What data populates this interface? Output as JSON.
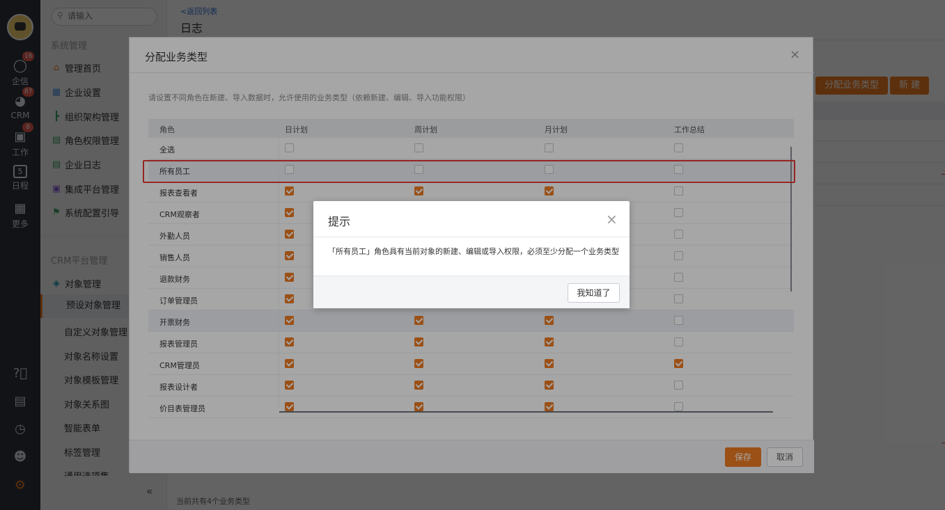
{
  "rail": {
    "items": [
      {
        "label": "企信",
        "icon": "chat-bubble-icon",
        "badge": "16"
      },
      {
        "label": "CRM",
        "icon": "pie-chart-icon",
        "badge": "87"
      },
      {
        "label": "工作",
        "icon": "briefcase-icon",
        "badge": "8"
      },
      {
        "label": "日程",
        "icon": "calendar-icon",
        "day": "5"
      },
      {
        "label": "更多",
        "icon": "grid-icon"
      }
    ],
    "bottom_icons": [
      "help-icon",
      "notebook-icon",
      "clock-icon",
      "contacts-icon",
      "gear-icon"
    ]
  },
  "menu": {
    "search_placeholder": "请输入",
    "section1": "系统管理",
    "items1": [
      {
        "label": "管理首页",
        "icon": "home-icon",
        "color": "#ee7c22"
      },
      {
        "label": "企业设置",
        "icon": "building-icon",
        "color": "#4a90e2"
      },
      {
        "label": "组织架构管理",
        "icon": "org-tree-icon",
        "color": "#3c9d5a"
      },
      {
        "label": "角色权限管理",
        "icon": "id-card-icon",
        "color": "#3c9d5a"
      },
      {
        "label": "企业日志",
        "icon": "log-icon",
        "color": "#3c9d5a"
      },
      {
        "label": "集成平台管理",
        "icon": "chip-icon",
        "color": "#8d5bd6"
      },
      {
        "label": "系统配置引导",
        "icon": "signpost-icon",
        "color": "#3c9d5a"
      }
    ],
    "section2": "CRM平台管理",
    "object_mgmt": "对象管理",
    "sub_items": [
      "预设对象管理",
      "自定义对象管理",
      "对象名称设置",
      "对象模板管理",
      "对象关系图",
      "智能表单",
      "标签管理",
      "通用选项集"
    ],
    "collapse": "«"
  },
  "page": {
    "back": "<返回列表",
    "title": "日志",
    "btn_assign": "分配业务类型",
    "btn_new": "新 建",
    "footer": "当前共有4个业务类型"
  },
  "dialog": {
    "title": "分配业务类型",
    "close": "×",
    "desc": "请设置不同角色在新建、导入数据时，允许使用的业务类型（依赖新建、编辑、导入功能权限）",
    "headers": [
      "角色",
      "日计划",
      "周计划",
      "月计划",
      "工作总结"
    ],
    "rows": [
      {
        "name": "全选",
        "checks": [
          false,
          false,
          false,
          false
        ]
      },
      {
        "name": "所有员工",
        "checks": [
          false,
          false,
          false,
          false
        ]
      },
      {
        "name": "报表查看者",
        "checks": [
          true,
          true,
          true,
          false
        ]
      },
      {
        "name": "CRM观察者",
        "checks": [
          true,
          true,
          true,
          false
        ]
      },
      {
        "name": "外勤人员",
        "checks": [
          true,
          true,
          true,
          false
        ]
      },
      {
        "name": "销售人员",
        "checks": [
          true,
          true,
          true,
          false
        ]
      },
      {
        "name": "退款财务",
        "checks": [
          true,
          true,
          true,
          false
        ]
      },
      {
        "name": "订单管理员",
        "checks": [
          true,
          true,
          true,
          false
        ]
      },
      {
        "name": "开票财务",
        "checks": [
          true,
          true,
          true,
          false
        ]
      },
      {
        "name": "报表管理员",
        "checks": [
          true,
          true,
          true,
          false
        ]
      },
      {
        "name": "CRM管理员",
        "checks": [
          true,
          true,
          true,
          true
        ]
      },
      {
        "name": "报表设计者",
        "checks": [
          true,
          true,
          true,
          false
        ]
      },
      {
        "name": "价目表管理员",
        "checks": [
          true,
          true,
          true,
          false
        ]
      }
    ],
    "save": "保存",
    "cancel": "取消"
  },
  "tip": {
    "title": "提示",
    "close": "×",
    "message": "「所有员工」角色具有当前对象的新建、编辑或导入权限，必须至少分配一个业务类型",
    "ok": "我知道了"
  },
  "colors": {
    "accent": "#ee7c22",
    "highlight_box": "#e53935",
    "rail_bg": "#2e333d"
  }
}
